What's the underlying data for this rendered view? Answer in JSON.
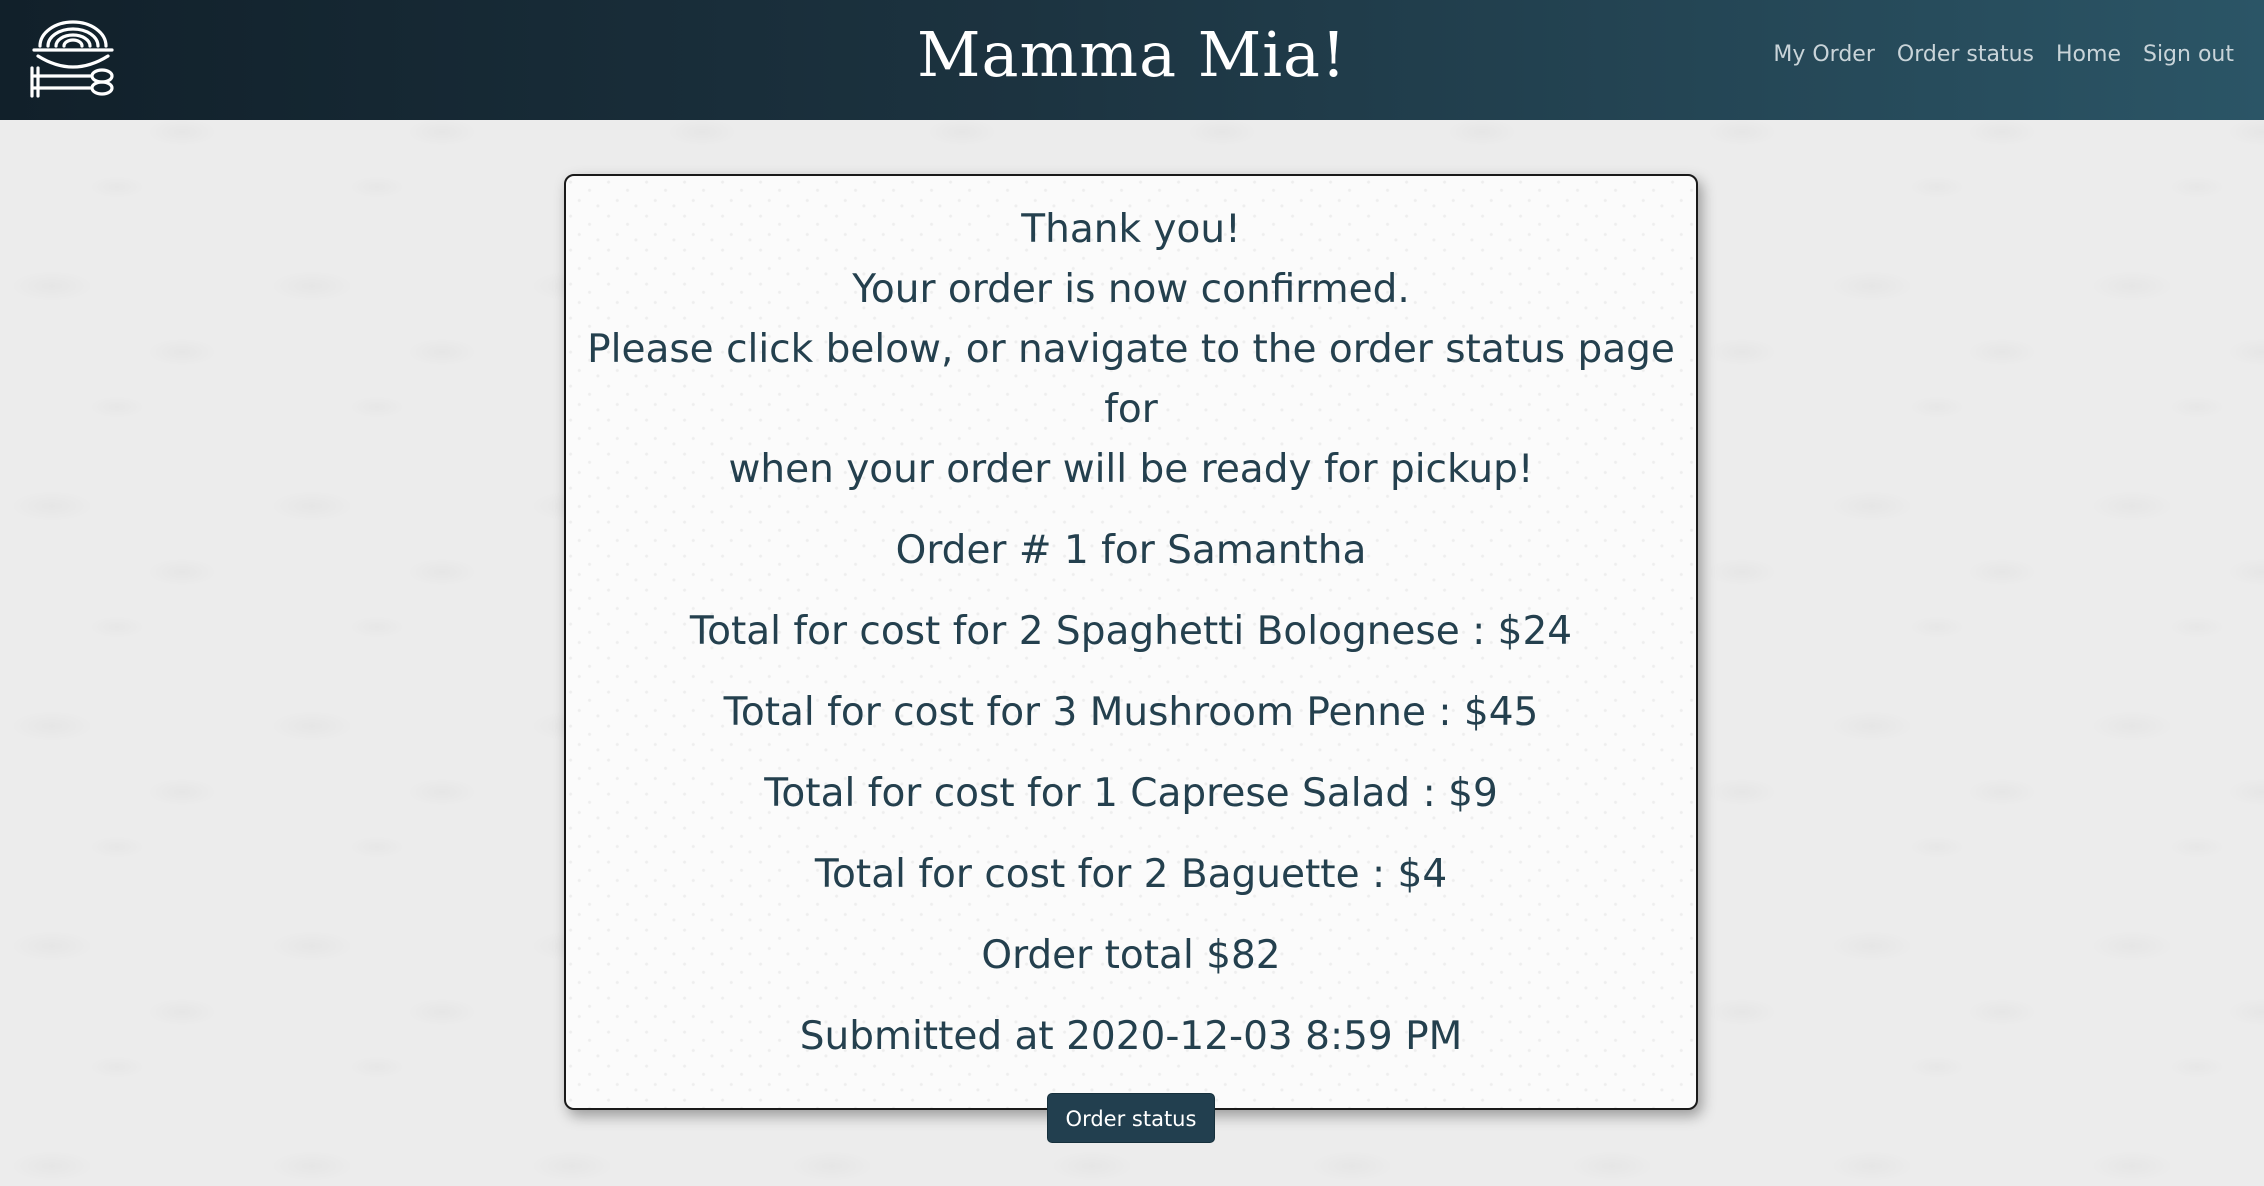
{
  "header": {
    "logo_icon": "pasta-plate-utensils-icon",
    "title": "Mamma Mia!",
    "nav": [
      {
        "label": "My Order"
      },
      {
        "label": "Order status"
      },
      {
        "label": "Home"
      },
      {
        "label": "Sign out"
      }
    ]
  },
  "confirmation": {
    "line1": "Thank you!",
    "line2": "Your order is now confirmed.",
    "line3": "Please click below, or navigate to the order status page for",
    "line4": "when your order will be ready for pickup!",
    "order_heading": "Order # 1 for Samantha",
    "items": [
      {
        "text": "Total for cost for 2 Spaghetti Bolognese : $24"
      },
      {
        "text": "Total for cost for 3 Mushroom Penne : $45"
      },
      {
        "text": "Total for cost for 1 Caprese Salad : $9"
      },
      {
        "text": "Total for cost for 2 Baguette : $4"
      }
    ],
    "order_total": "Order total $82",
    "submitted": "Submitted at 2020-12-03 8:59 PM",
    "button_label": "Order status"
  },
  "colors": {
    "navbar_start": "#11202a",
    "navbar_end": "#2b5566",
    "text": "#24404e",
    "button": "#223f4f"
  }
}
